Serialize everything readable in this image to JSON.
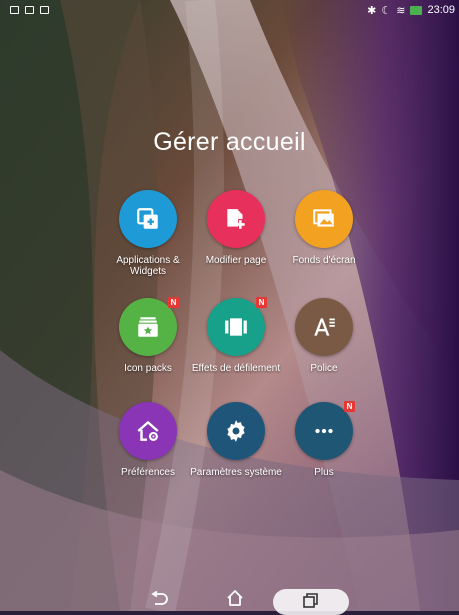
{
  "status_bar": {
    "time": "23:09"
  },
  "page": {
    "title": "Gérer accueil"
  },
  "items": [
    {
      "label": "Applications & Widgets",
      "icon": "add-widget-icon",
      "color": "#1e9bd7",
      "badge": ""
    },
    {
      "label": "Modifier page",
      "icon": "edit-page-icon",
      "color": "#e8305c",
      "badge": ""
    },
    {
      "label": "Fonds d'écran",
      "icon": "wallpaper-icon",
      "color": "#f2a120",
      "badge": ""
    },
    {
      "label": "Icon packs",
      "icon": "icon-packs-icon",
      "color": "#55b346",
      "badge": "N"
    },
    {
      "label": "Effets de défilement",
      "icon": "scroll-effects-icon",
      "color": "#17a08a",
      "badge": "N"
    },
    {
      "label": "Police",
      "icon": "font-icon",
      "color": "#7a5a45",
      "badge": ""
    },
    {
      "label": "Préférences",
      "icon": "preferences-icon",
      "color": "#8a35b6",
      "badge": ""
    },
    {
      "label": "Paramètres système",
      "icon": "settings-gear-icon",
      "color": "#20557a",
      "badge": ""
    },
    {
      "label": "Plus",
      "icon": "more-icon",
      "color": "#1f5673",
      "badge": "N"
    }
  ]
}
